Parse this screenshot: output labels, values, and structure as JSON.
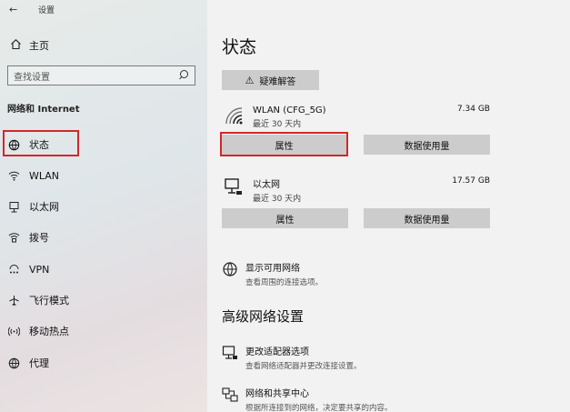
{
  "window": {
    "back_glyph": "←",
    "title": "设置"
  },
  "sidebar": {
    "home_label": "主页",
    "search_placeholder": "查找设置",
    "section_label": "网络和 Internet",
    "items": [
      {
        "label": "状态",
        "icon": "globe-icon",
        "active": true
      },
      {
        "label": "WLAN",
        "icon": "wifi-icon"
      },
      {
        "label": "以太网",
        "icon": "ethernet-icon"
      },
      {
        "label": "拨号",
        "icon": "dialup-icon"
      },
      {
        "label": "VPN",
        "icon": "vpn-icon"
      },
      {
        "label": "飞行模式",
        "icon": "airplane-icon"
      },
      {
        "label": "移动热点",
        "icon": "hotspot-icon"
      },
      {
        "label": "代理",
        "icon": "globe-icon"
      }
    ]
  },
  "main": {
    "title": "状态",
    "troubleshoot_label": "疑难解答",
    "wlan": {
      "name": "WLAN (CFG_5G)",
      "sub": "最近 30 天内",
      "size": "7.34 GB",
      "properties_label": "属性",
      "usage_label": "数据使用量"
    },
    "ethernet": {
      "name": "以太网",
      "sub": "最近 30 天内",
      "size": "17.57 GB",
      "properties_label": "属性",
      "usage_label": "数据使用量"
    },
    "show_networks": {
      "title": "显示可用网络",
      "desc": "查看周围的连接选项。"
    },
    "advanced_heading": "高级网络设置",
    "adapter_options": {
      "title": "更改适配器选项",
      "desc": "查看网络适配器并更改连接设置。"
    },
    "sharing_center": {
      "title": "网络和共享中心",
      "desc": "根据所连接到的网络，决定要共享的内容。"
    }
  },
  "colors": {
    "highlight": "#d0282d",
    "button_bg": "#cccccc",
    "main_bg": "#f2f2f2"
  }
}
